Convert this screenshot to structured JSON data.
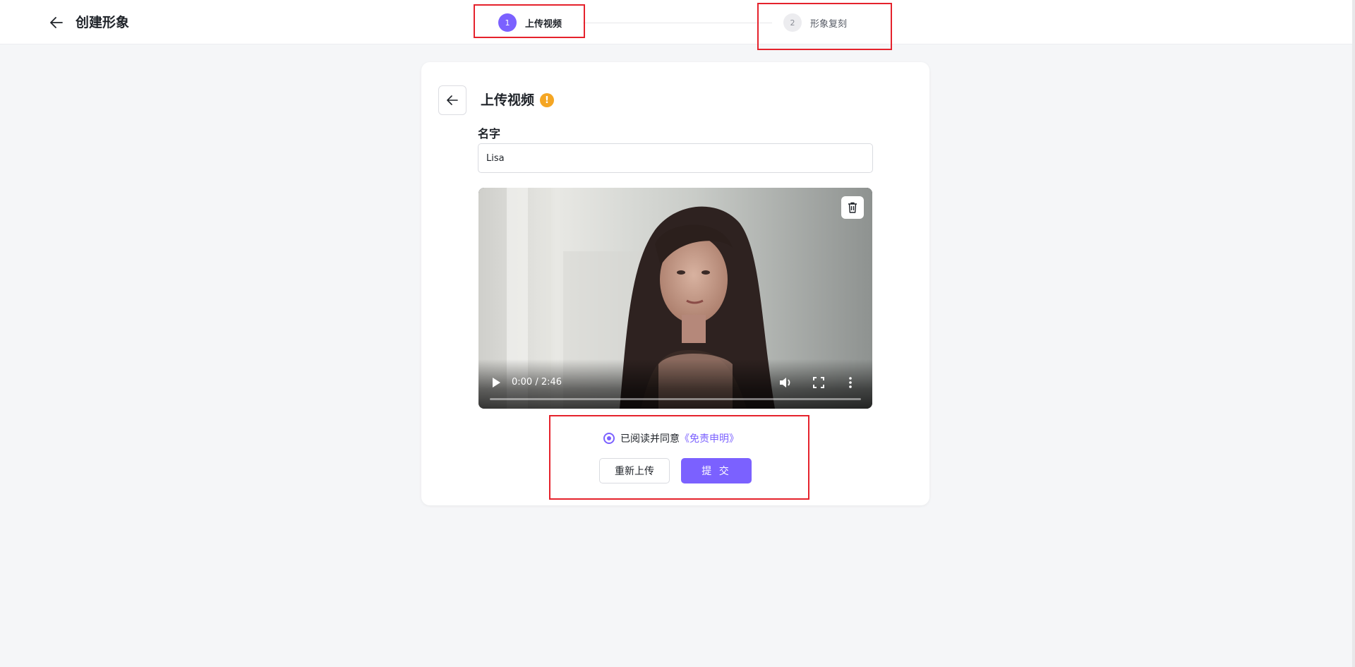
{
  "header": {
    "title": "创建形象",
    "steps": [
      {
        "number": "1",
        "label": "上传视频",
        "active": true
      },
      {
        "number": "2",
        "label": "形象复刻",
        "active": false
      }
    ]
  },
  "card": {
    "title": "上传视频",
    "name_label": "名字",
    "name_value": "Lisa",
    "video": {
      "time": "0:00 / 2:46",
      "progress": 0
    },
    "agree_text": "已阅读并同意",
    "agree_link": "《免责申明》",
    "reupload_label": "重新上传",
    "submit_label": "提 交"
  },
  "colors": {
    "accent": "#7b61ff",
    "warning": "#f5a623",
    "highlight": "#e5222c"
  }
}
